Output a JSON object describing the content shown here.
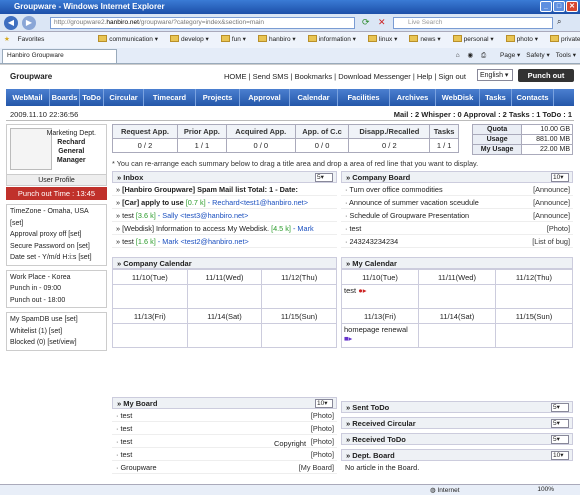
{
  "window": {
    "title": "Groupware - Windows Internet Explorer"
  },
  "browser": {
    "url_prefix": "http://groupware2.",
    "url_domain": "hanbiro.net",
    "url_suffix": "/groupware/?category=index&section=main",
    "search_placeholder": "Live Search",
    "favorites_label": "Favorites",
    "bookmarks": [
      "communication ▾",
      "develop ▾",
      "fun ▾",
      "hanbiro ▾",
      "information ▾",
      "linux ▾",
      "news ▾",
      "personal ▾",
      "photo ▾",
      "private ▾"
    ],
    "tab_title": "Hanbiro Groupware",
    "tools": [
      "Page ▾",
      "Safety ▾",
      "Tools ▾"
    ]
  },
  "app": {
    "title": "Groupware",
    "top_links": "HOME | Send SMS | Bookmarks | Download Messenger | Help | Sign out",
    "language": "English",
    "punch_out": "Punch out",
    "nav": [
      "WebMail",
      "Boards",
      "ToDo",
      "Circular",
      "Timecard",
      "Projects",
      "Approval",
      "Calendar",
      "Facilities",
      "Archives",
      "WebDisk",
      "Tasks",
      "Contacts"
    ],
    "datetime": "2009.11.10 22:36:56",
    "status": "Mail : 2   Whisper : 0   Approval : 2   Tasks : 1   ToDo : 1"
  },
  "profile": {
    "dept": "Marketing Dept.",
    "name": "Rechard",
    "position": "General Manager",
    "user_profile": "User Profile",
    "punch_time": "Punch out Time : 13:45"
  },
  "settings1": [
    "TimeZone - Omaha, USA [set]",
    "Approval proxy off [set]",
    "Secure Password on [set]",
    "Date set - Y/m/d H:i:s [set]"
  ],
  "settings2": [
    "Work Place - Korea",
    "Punch in - 09:00",
    "Punch out - 18:00"
  ],
  "settings3": [
    "My SpamDB use [set]",
    "Whitelist (1) [set]",
    "Blocked (0) [set/view]"
  ],
  "summary": {
    "headers": [
      "Request App.",
      "Prior App.",
      "Acquired App.",
      "App. of C.c",
      "Disapp./Recalled",
      "Tasks"
    ],
    "values": [
      "0 / 2",
      "1 / 1",
      "0 / 0",
      "0 / 0",
      "0 / 2",
      "1 / 1"
    ]
  },
  "quota": [
    {
      "k": "Quota",
      "v": "10.00 GB"
    },
    {
      "k": "Usage",
      "v": "881.00 MB"
    },
    {
      "k": "My Usage",
      "v": "22.00 MB"
    }
  ],
  "tip": "* You can re-arrange each summary below to drag a title area and drop a area of red line that you want to display.",
  "inbox": {
    "title": "Inbox",
    "count": "5",
    "items": [
      {
        "pre": "» ",
        "bold": "[Hanbiro Groupware] Spam Mail list Total: 1 - Date:",
        "size": "",
        "who": ""
      },
      {
        "pre": "» ",
        "bold": "[Car] apply to use",
        "size": "[0.7 k]",
        "who": "- Rechard<test1@hanbiro.net>"
      },
      {
        "pre": "» test ",
        "bold": "",
        "size": "[3.6 k]",
        "who": "- Sally <test3@hanbiro.net>"
      },
      {
        "pre": "» [Webdisk] Information to access My Webdisk.",
        "bold": "",
        "size": "[4.5 k]",
        "who": "- Mark"
      },
      {
        "pre": "» test ",
        "bold": "",
        "size": "[1.6 k]",
        "who": "- Mark <test2@hanbiro.net>"
      }
    ]
  },
  "company_board": {
    "title": "Company Board",
    "count": "10",
    "items": [
      {
        "t": "· Turn over office commodities",
        "c": "[Announce]"
      },
      {
        "t": "· Announce of summer vacation sceudule",
        "c": "[Announce]"
      },
      {
        "t": "· Schedule of Groupware Presentation",
        "c": "[Announce]"
      },
      {
        "t": "· test",
        "c": "[Photo]"
      },
      {
        "t": "· 243243234234",
        "c": "[List of bug]"
      }
    ]
  },
  "company_calendar": {
    "title": "Company Calendar",
    "row1": [
      "11/10(Tue)",
      "11/11(Wed)",
      "11/12(Thu)"
    ],
    "row2": [
      "11/13(Fri)",
      "11/14(Sat)",
      "11/15(Sun)"
    ]
  },
  "my_calendar": {
    "title": "My Calendar",
    "row1": [
      "11/10(Tue)",
      "11/11(Wed)",
      "11/12(Thu)"
    ],
    "row2": [
      "11/13(Fri)",
      "11/14(Sat)",
      "11/15(Sun)"
    ],
    "event1": "test",
    "event2": "homepage renewal"
  },
  "my_board": {
    "title": "My Board",
    "count": "10",
    "items": [
      {
        "t": "· test",
        "c": "[Photo]"
      },
      {
        "t": "· test",
        "c": "[Photo]"
      },
      {
        "t": "· test",
        "c": "[Photo]"
      },
      {
        "t": "· test",
        "c": "[Photo]"
      },
      {
        "t": "· Groupware",
        "c": "[My Board]"
      }
    ]
  },
  "sent_todo": {
    "title": "Sent ToDo",
    "count": "5"
  },
  "received_circular": {
    "title": "Received Circular",
    "count": "5"
  },
  "received_todo": {
    "title": "Received ToDo",
    "count": "5"
  },
  "dept_board": {
    "title": "Dept. Board",
    "count": "10",
    "empty": "No article in the Board."
  },
  "copyright": "Copyright",
  "statusbar": {
    "zone": "Internet",
    "zoom": "100%"
  }
}
